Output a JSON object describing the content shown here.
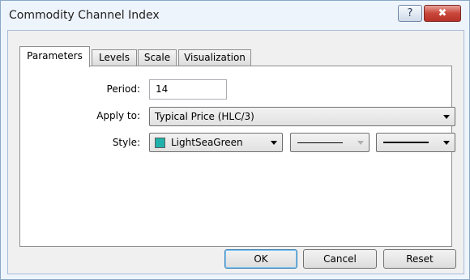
{
  "window": {
    "title": "Commodity Channel Index",
    "help_label": "?",
    "close_label": "✖"
  },
  "tabs": [
    {
      "label": "Parameters",
      "active": true
    },
    {
      "label": "Levels",
      "active": false
    },
    {
      "label": "Scale",
      "active": false
    },
    {
      "label": "Visualization",
      "active": false
    }
  ],
  "params": {
    "period_label": "Period:",
    "period_value": "14",
    "apply_label": "Apply to:",
    "apply_value": "Typical Price (HLC/3)",
    "style_label": "Style:",
    "color_name": "LightSeaGreen",
    "color_hex": "#20b2aa",
    "line_style_icon": "solid-line-icon",
    "line_width_icon": "thick-line-icon"
  },
  "buttons": {
    "ok": "OK",
    "cancel": "Cancel",
    "reset": "Reset"
  }
}
